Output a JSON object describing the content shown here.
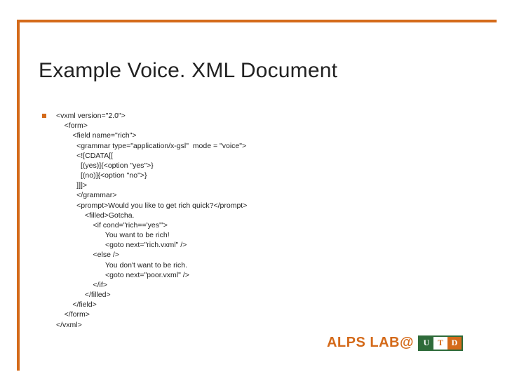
{
  "title": "Example Voice. XML Document",
  "code": "<vxml version=\"2.0\">\n    <form>\n        <field name=\"rich\">\n          <grammar type=\"application/x-gsl\"  mode = \"voice\">\n          <![CDATA[[\n            [(yes)]{<option \"yes\">}\n            [(no)]{<option \"no\">}\n          ]]]>\n          </grammar>\n          <prompt>Would you like to get rich quick?</prompt>\n              <filled>Gotcha.\n                  <if cond=\"rich=='yes'\">\n                        You want to be rich!\n                        <goto next=\"rich.vxml\" />\n                  <else />\n                        You don't want to be rich.\n                        <goto next=\"poor.vxml\" />\n                  </if>\n              </filled>\n        </field>\n    </form>\n</vxml>",
  "footer": {
    "text": "ALPS LAB@",
    "badge": {
      "u": "U",
      "t": "T",
      "d": "D"
    }
  }
}
